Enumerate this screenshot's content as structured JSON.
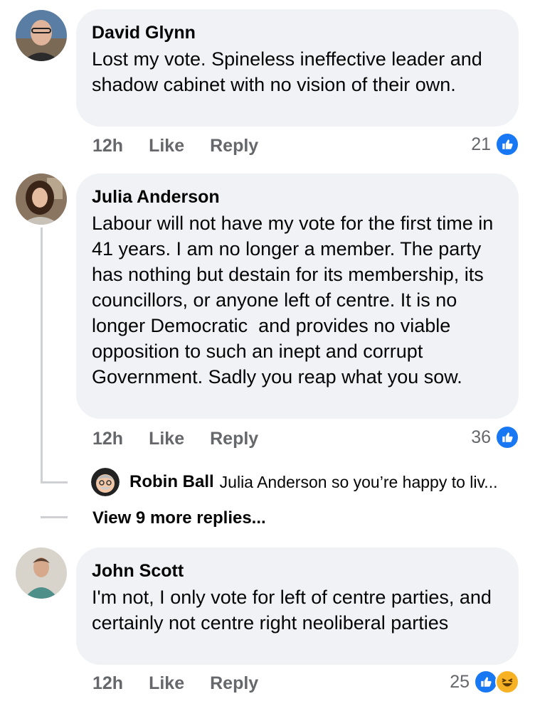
{
  "comments": [
    {
      "author": "David Glynn",
      "text": "Lost my vote. Spineless ineffective leader and shadow cabinet with no vision of their own.",
      "time": "12h",
      "like_label": "Like",
      "reply_label": "Reply",
      "reaction_count": "21",
      "reactions": [
        "like"
      ]
    },
    {
      "author": "Julia Anderson",
      "text": "Labour will not have my vote for the first time in 41 years. I am no longer a member. The party has nothing but destain for its membership, its councillors, or anyone left of centre. It is no longer Democratic  and provides no viable opposition to such an inept and corrupt Government. Sadly you reap what you sow.",
      "time": "12h",
      "like_label": "Like",
      "reply_label": "Reply",
      "reaction_count": "36",
      "reactions": [
        "like"
      ],
      "reply_preview": {
        "author": "Robin Ball",
        "text": "Julia Anderson so you’re happy to liv..."
      },
      "view_more": "View 9 more replies..."
    },
    {
      "author": "John Scott",
      "text": "I'm not, I only vote for left of centre parties, and certainly not centre right neoliberal parties",
      "time": "12h",
      "like_label": "Like",
      "reply_label": "Reply",
      "reaction_count": "25",
      "reactions": [
        "like",
        "haha"
      ]
    }
  ],
  "colors": {
    "bubble": "#f0f2f5",
    "meta_text": "#65676b",
    "like_blue": "#1877f2",
    "haha_yellow": "#f7b125"
  }
}
